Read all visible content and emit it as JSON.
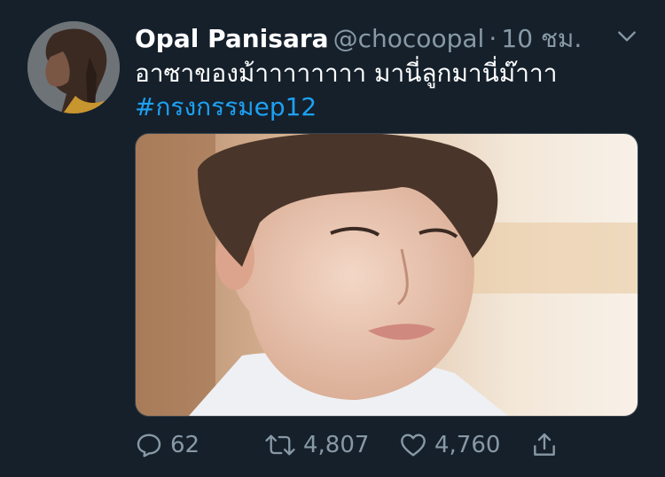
{
  "tweet": {
    "display_name": "Opal Panisara",
    "handle": "@chocoopal",
    "separator": "·",
    "time": "10 ชม.",
    "text_line1": "อาซาของม้าาาาาาาา มานี่ลูกมานี่ม๊าาา",
    "hashtag": "#กรงกรรมep12"
  },
  "actions": {
    "reply_count": "62",
    "retweet_count": "4,807",
    "like_count": "4,760"
  },
  "icons": {
    "caret": "chevron-down-icon",
    "reply": "reply-icon",
    "retweet": "retweet-icon",
    "like": "heart-icon",
    "share": "share-icon"
  },
  "colors": {
    "background": "#15202b",
    "secondary_text": "#8899a6",
    "link": "#1da1f2"
  }
}
